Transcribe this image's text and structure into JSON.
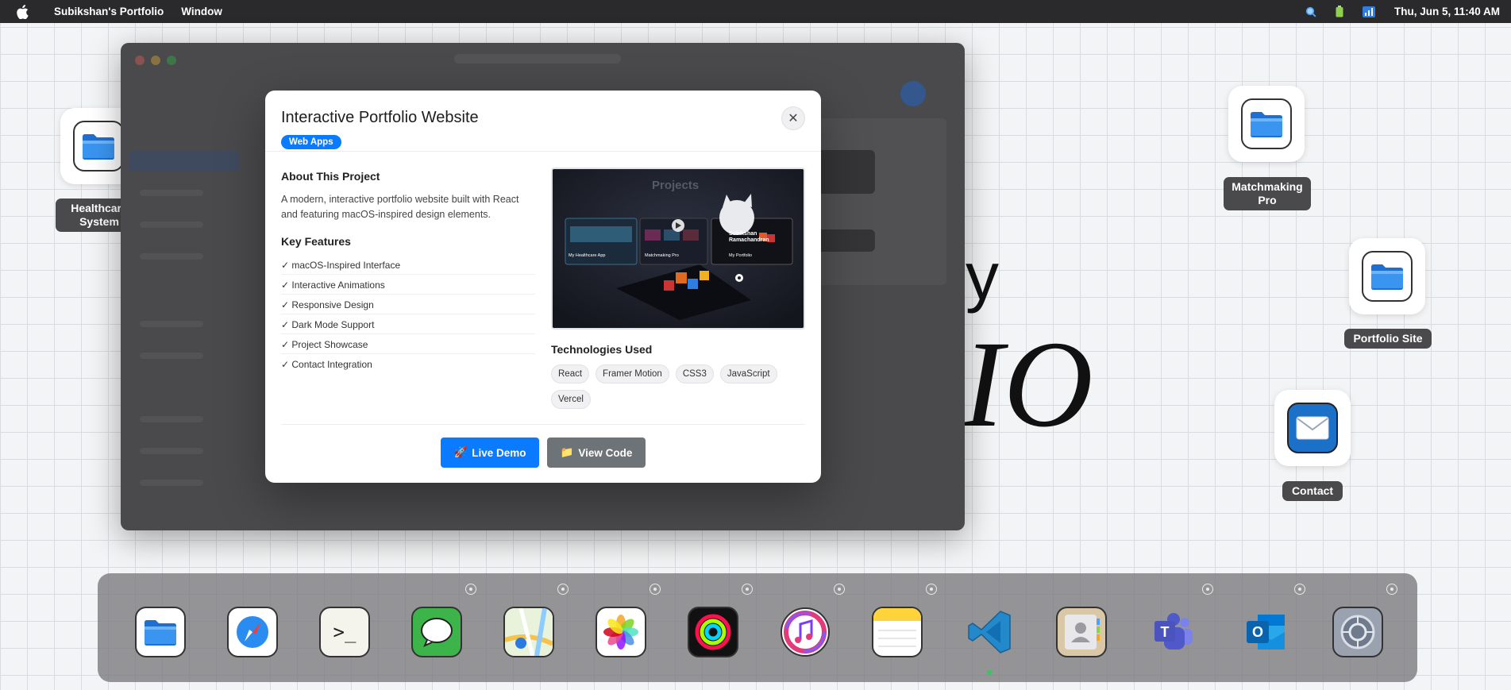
{
  "menubar": {
    "app_name": "Subikshan's Portfolio",
    "menu_window": "Window",
    "datetime": "Thu, Jun 5, 11:40 AM",
    "icons": [
      "apple-icon",
      "search-icon",
      "battery-icon",
      "wifi-icon"
    ]
  },
  "background_text": {
    "line1": "y",
    "line2": "IO"
  },
  "desktop": {
    "healthcare": {
      "label_l1": "Healthcare",
      "label_l2": "System"
    },
    "matchmaking": {
      "label_l1": "Matchmaking",
      "label_l2": "Pro"
    },
    "portfolio_site": {
      "label": "Portfolio Site"
    },
    "contact": {
      "label": "Contact"
    }
  },
  "modal": {
    "title": "Interactive Portfolio Website",
    "category": "Web Apps",
    "about_heading": "About This Project",
    "about_text": "A modern, interactive portfolio website built with React and featuring macOS-inspired design elements.",
    "features_heading": "Key Features",
    "features": [
      "✓ macOS-Inspired Interface",
      "✓ Interactive Animations",
      "✓ Responsive Design",
      "✓ Dark Mode Support",
      "✓ Project Showcase",
      "✓ Contact Integration"
    ],
    "screenshot": {
      "heading": "Projects",
      "card1": "My Healthcare App",
      "card2": "Matchmaking Pro",
      "card3_name": "Subikshan Ramachandran",
      "card3_sub": "My Portfolio"
    },
    "tech_heading": "Technologies Used",
    "technologies": [
      "React",
      "Framer Motion",
      "CSS3",
      "JavaScript",
      "Vercel"
    ],
    "live_demo": "Live Demo",
    "view_code": "View Code",
    "live_demo_icon": "rocket-icon",
    "view_code_icon": "folder-icon"
  },
  "dock": {
    "apps": [
      "Finder",
      "Safari",
      "Terminal",
      "Messages",
      "Maps",
      "Photos",
      "Activity",
      "Music",
      "Notes",
      "VS Code",
      "Contacts",
      "Teams",
      "Outlook",
      "System Settings"
    ]
  },
  "colors": {
    "accent": "#0a7aff",
    "secondary_button": "#6e7378",
    "running": "#34c759"
  }
}
